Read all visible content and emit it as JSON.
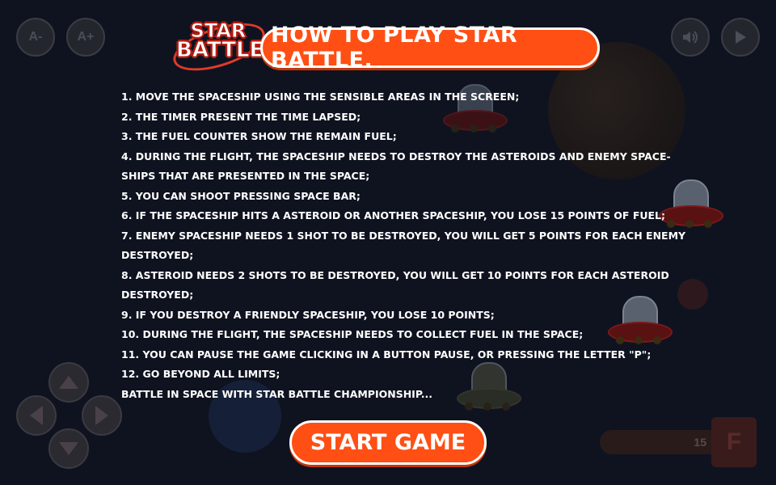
{
  "colors": {
    "accent": "#ff4f14",
    "background": "#0f1320",
    "text": "#ffffff"
  },
  "top_controls": {
    "font_decrease": "A-",
    "font_increase": "A+",
    "sound_icon": "speaker-icon",
    "play_icon": "play-icon"
  },
  "logo": {
    "line1": "STAR",
    "line2": "BATTLE"
  },
  "title": "HOW TO PLAY STAR BATTLE.",
  "rules": [
    "1. Move the spaceship using the sensible areas in the screen;",
    "2. The timer present the time lapsed;",
    "3. The fuel counter show the remain fuel;",
    "4. During the flight, the spaceship needs to destroy the asteroids and enemy space-",
    "ships that are presented in the space;",
    "5. You can shoot pressing space bar;",
    "6. If the spaceship hits a asteroid or another spaceship, you lose 15 points of fuel;",
    "7. Enemy spaceship needs 1 shot to be destroyed, you will get 5 points for each enemy",
    "destroyed;",
    "8. Asteroid needs 2 shots to be destroyed, you will get 10 points for each asteroid",
    "destroyed;",
    "9. If you destroy a friendly spaceship, you lose 10 points;",
    "10. During the flight, the spaceship needs to collect fuel in the space;",
    "11. You can pause the game clicking in a button pause, or pressing the letter \"p\";",
    "12. Go beyond all limits;",
    "Battle in space with Star Battle Championship..."
  ],
  "start_button": "START GAME",
  "hud": {
    "fuel_value": "15",
    "fuel_icon_letter": "F"
  }
}
